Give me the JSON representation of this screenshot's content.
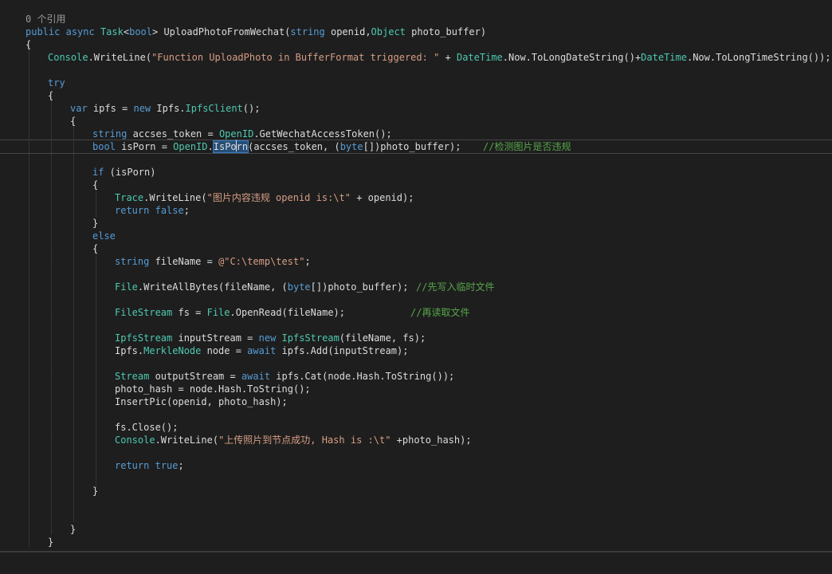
{
  "editor": {
    "reference_count": "0 个引用",
    "method_signature": {
      "kw_public": "public",
      "kw_async": "async",
      "type_task": "Task",
      "lt": "<",
      "kw_bool": "bool",
      "gt_name": "> UploadPhotoFromWechat(",
      "kw_string": "string",
      "param1": " openid,",
      "type_object": "Object",
      "param2": " photo_buffer)"
    },
    "lines": {
      "open_brace": "{",
      "console_line": {
        "type_console": "Console",
        "method": ".WriteLine(",
        "string": "\"Function UploadPhoto in BufferFormat triggered: \"",
        "plus": " + ",
        "type_datetime1": "DateTime",
        "rest1": ".Now.ToLongDateString()+",
        "type_datetime2": "DateTime",
        "rest2": ".Now.ToLongTimeString());"
      },
      "try": "try",
      "var_ipfs": {
        "kw_var": "var",
        "mid": " ipfs = ",
        "kw_new": "new",
        "ns": " Ipfs.",
        "type_client": "IpfsClient",
        "end": "();"
      },
      "token_line": {
        "kw_string": "string",
        "mid": " accses_token = ",
        "type_openid": "OpenID",
        "end": ".GetWechatAccessToken();"
      },
      "isporn_line": {
        "kw_bool": "bool",
        "mid": " isPorn = ",
        "type_openid": "OpenID",
        "dot": ".",
        "method_a": "IsPo",
        "method_b": "rn",
        "args": "(accses_token, (",
        "kw_byte": "byte",
        "args_end": "[])photo_buffer);",
        "comment": "//检测图片是否违规"
      },
      "if_line": {
        "kw_if": "if",
        "cond": " (isPorn)"
      },
      "trace_line": {
        "type_trace": "Trace",
        "method": ".WriteLine(",
        "string": "\"图片内容违规 openid is:\\t\"",
        "end": " + openid);"
      },
      "return_false": {
        "kw_return": "return",
        "kw_false": "false",
        "end": ";"
      },
      "close_brace": "}",
      "else": "else",
      "filename_line": {
        "kw_string": "string",
        "mid": " fileName = ",
        "string": "@\"C:\\temp\\test\"",
        "end": ";"
      },
      "write_line": {
        "type_file": "File",
        "mid": ".WriteAllBytes(fileName, (",
        "kw_byte": "byte",
        "end": "[])photo_buffer);",
        "comment": "//先写入临时文件"
      },
      "filestream_line": {
        "type_filestream": "FileStream",
        "mid": " fs = ",
        "type_file": "File",
        "end": ".OpenRead(fileName);",
        "comment": "//再读取文件"
      },
      "ipfsstream_line": {
        "type_ipfsstream": "IpfsStream",
        "mid": " inputStream = ",
        "kw_new": "new",
        "sp": " ",
        "type_ipfsstream2": "IpfsStream",
        "end": "(fileName, fs);"
      },
      "merkle_line": {
        "ns": "Ipfs.",
        "type_merkle": "MerkleNode",
        "mid": " node = ",
        "kw_await": "await",
        "end": " ipfs.Add(inputStream);"
      },
      "stream_line": {
        "type_stream": "Stream",
        "mid": " outputStream = ",
        "kw_await": "await",
        "end": " ipfs.Cat(node.Hash.ToString());"
      },
      "hash_line": "photo_hash = node.Hash.ToString();",
      "insert_line": "InsertPic(openid, photo_hash);",
      "close_line": "fs.Close();",
      "success_line": {
        "type_console": "Console",
        "method": ".WriteLine(",
        "string": "\"上传照片到节点成功, Hash is :\\t\"",
        "end": " +photo_hash);"
      },
      "return_true": {
        "kw_return": "return",
        "kw_true": "true",
        "end": ";"
      }
    },
    "colors": {
      "background": "#1e1e1e",
      "keyword": "#569cd6",
      "type": "#4ec9b0",
      "string": "#d69d85",
      "comment": "#57a64a",
      "plain": "#dcdcdc",
      "selection": "#264f78"
    }
  }
}
